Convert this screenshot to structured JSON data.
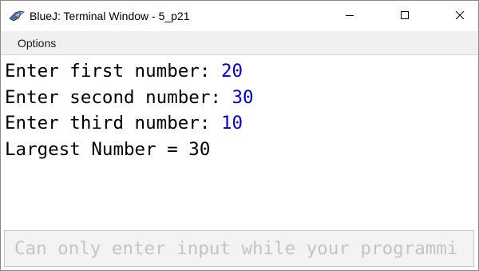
{
  "window": {
    "title": "BlueJ: Terminal Window - 5_p21",
    "icon": "bluej-bird-icon",
    "controls": {
      "minimize_icon": "minimize-icon",
      "maximize_icon": "maximize-icon",
      "close_icon": "close-icon"
    }
  },
  "menu": {
    "items": [
      {
        "label": "Options"
      }
    ]
  },
  "terminal": {
    "lines": [
      {
        "prompt": "Enter first number: ",
        "input": "20"
      },
      {
        "prompt": "Enter second number: ",
        "input": "30"
      },
      {
        "prompt": "Enter third number: ",
        "input": "10"
      },
      {
        "prompt": "Largest Number = 30",
        "input": ""
      }
    ],
    "input_color": "#0000c8",
    "output_color": "#000000"
  },
  "input_field": {
    "placeholder": "Can only enter input while your programmi"
  }
}
